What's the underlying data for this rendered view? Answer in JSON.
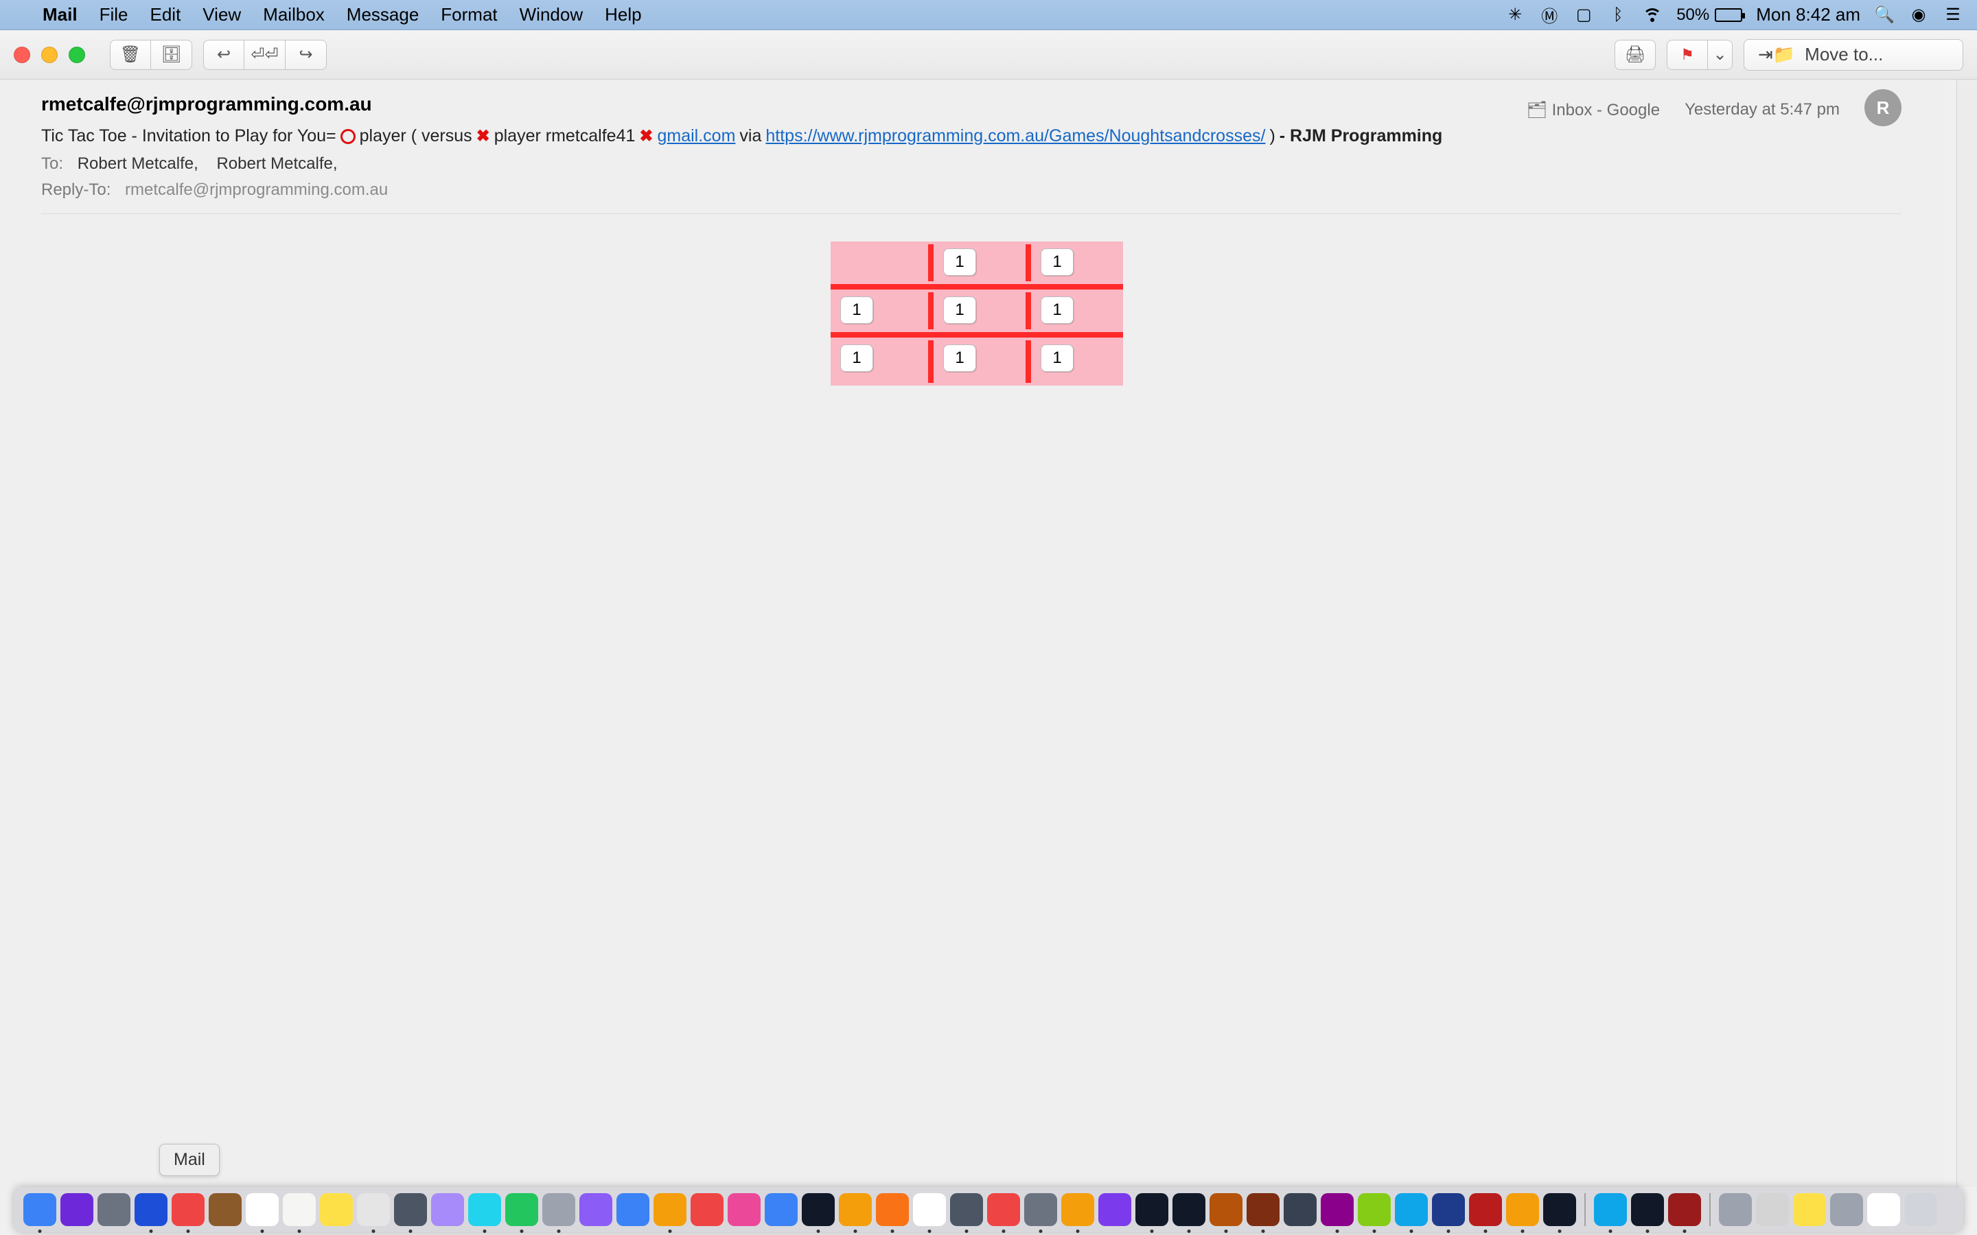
{
  "menubar": {
    "app_name": "Mail",
    "menus": [
      "File",
      "Edit",
      "View",
      "Mailbox",
      "Message",
      "Format",
      "Window",
      "Help"
    ],
    "battery_pct": "50%",
    "clock": "Mon 8:42 am"
  },
  "toolbar": {
    "move_to_label": "Move to..."
  },
  "header": {
    "from": "rmetcalfe@rjmprogramming.com.au",
    "mailbox_label": "Inbox - Google",
    "received": "Yesterday at 5:47 pm",
    "avatar_initial": "R",
    "subject_prefix": "Tic Tac Toe - Invitation to Play  for You=",
    "subject_mid1": " player ( versus ",
    "subject_mid2": " player rmetcalfe41",
    "gmail_link": "gmail.com",
    "via": " via  ",
    "url_link": "https://www.rjmprogramming.com.au/Games/Noughtsandcrosses/",
    "subject_suffix_bold": " - RJM Programming",
    "close_paren": " ) ",
    "to_label": "To:",
    "to_names": [
      "Robert Metcalfe,",
      "Robert Metcalfe,"
    ],
    "reply_to_label": "Reply-To:",
    "reply_to_value": "rmetcalfe@rjmprogramming.com.au"
  },
  "board": {
    "cells": [
      [
        "",
        "1",
        "1"
      ],
      [
        "1",
        "1",
        "1"
      ],
      [
        "1",
        "1",
        "1"
      ]
    ]
  },
  "dock": {
    "tooltip": "Mail",
    "apps": [
      {
        "c": "#3b82f6",
        "r": true
      },
      {
        "c": "#6d28d9",
        "r": false
      },
      {
        "c": "#6b7280",
        "r": false
      },
      {
        "c": "#1d4ed8",
        "r": true
      },
      {
        "c": "#ef4444",
        "r": true
      },
      {
        "c": "#8b5a2b",
        "r": false
      },
      {
        "c": "#ffffff",
        "r": true
      },
      {
        "c": "#f5f5f4",
        "r": true
      },
      {
        "c": "#fde047",
        "r": false
      },
      {
        "c": "#e5e5e5",
        "r": true
      },
      {
        "c": "#4b5563",
        "r": true
      },
      {
        "c": "#a78bfa",
        "r": false
      },
      {
        "c": "#22d3ee",
        "r": true
      },
      {
        "c": "#22c55e",
        "r": true
      },
      {
        "c": "#9ca3af",
        "r": true
      },
      {
        "c": "#8b5cf6",
        "r": false
      },
      {
        "c": "#3b82f6",
        "r": false
      },
      {
        "c": "#f59e0b",
        "r": true
      },
      {
        "c": "#ef4444",
        "r": false
      },
      {
        "c": "#ec4899",
        "r": false
      },
      {
        "c": "#3b82f6",
        "r": false
      },
      {
        "c": "#111827",
        "r": true
      },
      {
        "c": "#f59e0b",
        "r": true
      },
      {
        "c": "#f97316",
        "r": true
      },
      {
        "c": "#ffffff",
        "r": true
      },
      {
        "c": "#4b5563",
        "r": true
      },
      {
        "c": "#ef4444",
        "r": true
      },
      {
        "c": "#6b7280",
        "r": true
      },
      {
        "c": "#f59e0b",
        "r": true
      },
      {
        "c": "#7c3aed",
        "r": false
      },
      {
        "c": "#111827",
        "r": true
      },
      {
        "c": "#111827",
        "r": true
      },
      {
        "c": "#b45309",
        "r": true
      },
      {
        "c": "#7c2d12",
        "r": true
      },
      {
        "c": "#374151",
        "r": false
      },
      {
        "c": "#8b008b",
        "r": true
      },
      {
        "c": "#84cc16",
        "r": true
      },
      {
        "c": "#0ea5e9",
        "r": true
      },
      {
        "c": "#1e3a8a",
        "r": true
      },
      {
        "c": "#b91c1c",
        "r": true
      },
      {
        "c": "#f59e0b",
        "r": true
      },
      {
        "c": "#111827",
        "r": true
      },
      {
        "c": "#0ea5e9",
        "r": true
      },
      {
        "c": "#111827",
        "r": true
      },
      {
        "c": "#991b1b",
        "r": true
      },
      {
        "c": "#9ca3af",
        "r": false
      },
      {
        "c": "#d4d4d4",
        "r": false
      },
      {
        "c": "#fde047",
        "r": false
      },
      {
        "c": "#9ca3af",
        "r": false
      },
      {
        "c": "#ffffff",
        "r": false
      },
      {
        "c": "#d1d5db",
        "r": false
      }
    ],
    "divider_after": [
      41,
      44
    ]
  }
}
